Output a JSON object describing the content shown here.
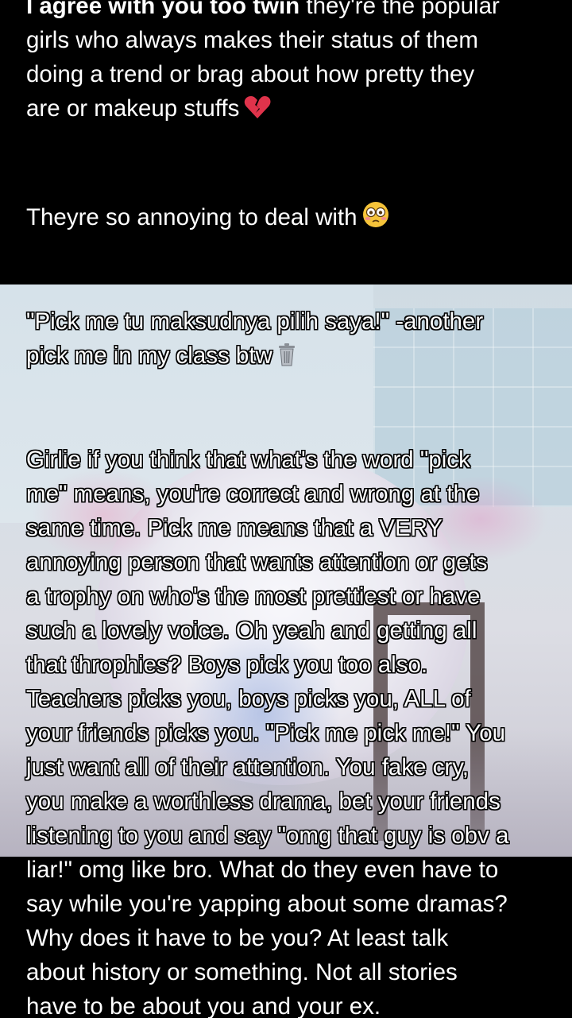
{
  "post": {
    "p1": {
      "line1_bold": "I agree with you too twin",
      "line1_rest": " they're the popular",
      "line2": "girls who always makes their status of them",
      "line3": "doing a trend or brag about how pretty they",
      "line4": "are or makeup stuffs",
      "emoji": "broken-heart-icon"
    },
    "p2": {
      "line1": "Theyre so annoying to deal with",
      "emoji": "flushed-face-icon"
    },
    "p3": {
      "line1": "\"Pick me tu maksudnya pilih saya!\" -another",
      "line2": "pick me in my class btw",
      "emoji": "trash-can-icon"
    },
    "p4": {
      "lines": [
        "Girlie if you think that what's the word \"pick",
        "me\" means, you're correct and wrong at the",
        "same time. Pick me means that a VERY",
        "annoying person that wants attention or gets",
        "a trophy on who's the most prettiest or have",
        "such a lovely voice. Oh yeah and getting all",
        "that throphies? Boys pick you too also.",
        "Teachers picks you, boys picks you, ALL of",
        "your friends picks you. \"Pick me pick me!\" You",
        "just want all of their attention. You fake cry,",
        "you make a worthless drama, bet your friends",
        "listening to you and say \"omg that guy is obv a",
        "liar!\" omg like bro. What do they even have to",
        "say while you're yapping about some dramas?",
        "Why does it have to be you? At least talk",
        "about history or something. Not all stories",
        "have to be about you and your ex."
      ]
    }
  },
  "colors": {
    "text": "#ffffff",
    "background": "#000000",
    "emoji_red": "#e0334b",
    "emoji_yellow": "#f6c43a"
  }
}
